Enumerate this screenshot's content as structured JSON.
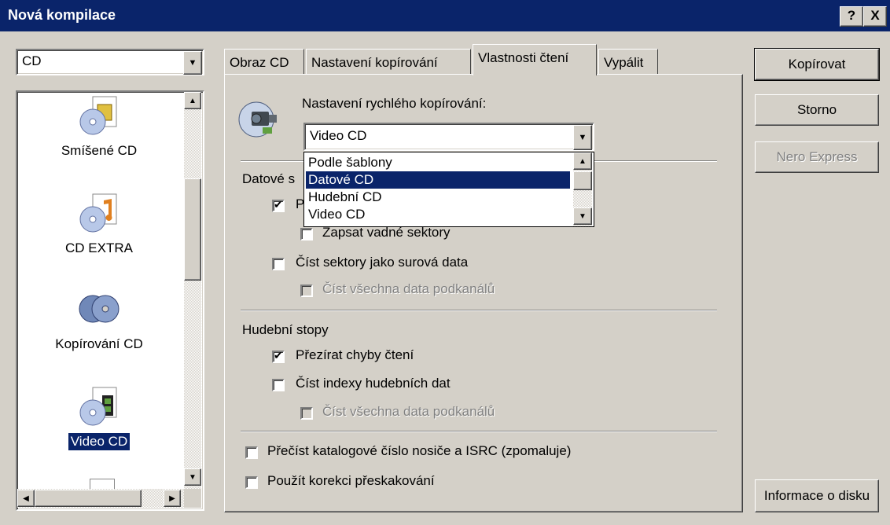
{
  "window": {
    "title": "Nová kompilace",
    "help_btn": "?",
    "close_btn": "X"
  },
  "left": {
    "media_combo": "CD",
    "items": [
      {
        "label": "Smíšené CD",
        "icon": "mixed-cd-icon"
      },
      {
        "label": "CD EXTRA",
        "icon": "cd-extra-icon"
      },
      {
        "label": "Kopírování CD",
        "icon": "copy-cd-icon",
        "selected": true
      },
      {
        "label": "Video CD",
        "icon": "video-cd-icon"
      }
    ]
  },
  "tabs": [
    {
      "label": "Obraz CD"
    },
    {
      "label": "Nastavení kopírování"
    },
    {
      "label": "Vlastnosti čtení",
      "active": true
    },
    {
      "label": "Vypálit"
    }
  ],
  "panel": {
    "quick_copy_label": "Nastavení rychlého kopírování:",
    "quick_copy_value": "Video CD",
    "dropdown_options": [
      {
        "label": "Podle šablony"
      },
      {
        "label": "Datové CD",
        "selected": true
      },
      {
        "label": "Hudební CD"
      },
      {
        "label": "Video CD"
      }
    ],
    "data_group_label": "Datové s",
    "data_option1_partial": "P",
    "write_bad_sectors": "Zapsat vadné sektory",
    "read_raw": "Číst sektory jako surová data",
    "read_subchannel": "Číst všechna data podkanálů",
    "audio_group_label": "Hudební stopy",
    "ignore_errors": "Přezírat chyby čtení",
    "read_indexes": "Číst indexy hudebních dat",
    "read_subchannel_audio": "Číst všechna data podkanálů",
    "read_catalog": "Přečíst katalogové číslo nosiče a ISRC (zpomaluje)",
    "jitter": "Použít korekci přeskakování"
  },
  "buttons": {
    "copy": "Kopírovat",
    "cancel": "Storno",
    "nero_express": "Nero Express",
    "disc_info": "Informace o disku"
  }
}
